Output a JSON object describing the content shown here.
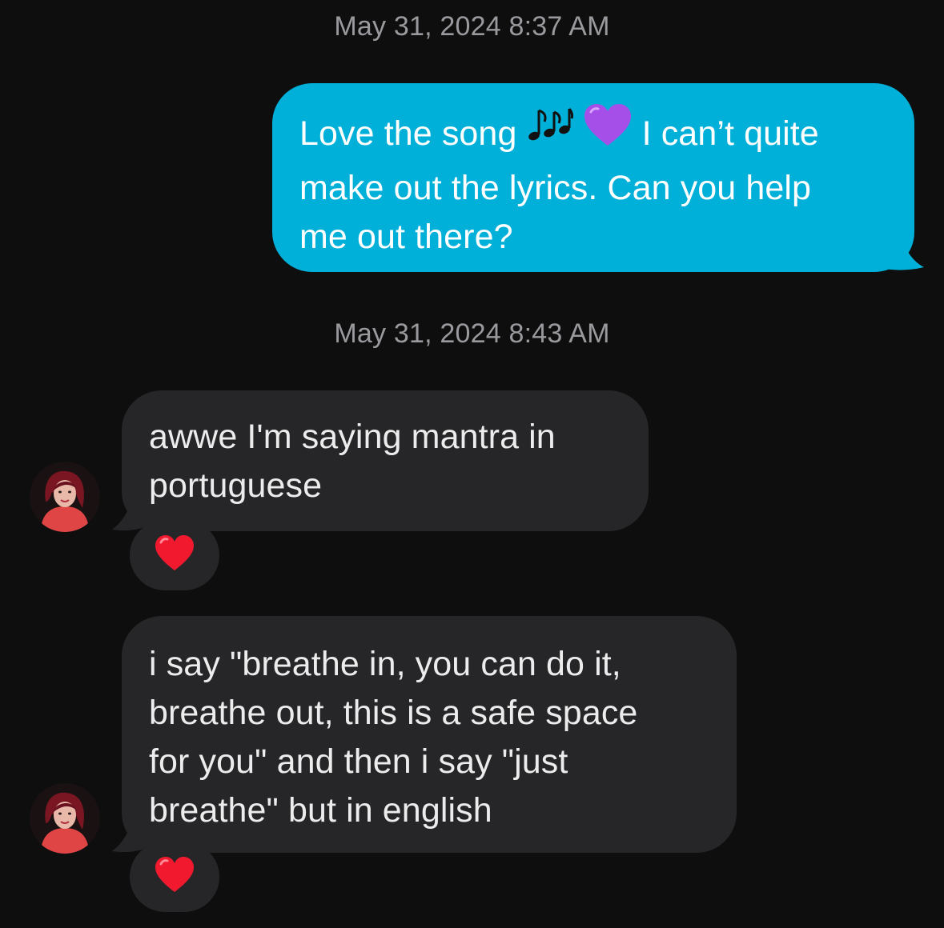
{
  "conversation": {
    "timestamps": [
      "May 31, 2024 8:37 AM",
      "May 31, 2024 8:43 AM"
    ],
    "outgoing": {
      "part1": "Love the song",
      "part2": "I can’t quite",
      "line2": "make out the lyrics. Can you help",
      "line3": "me out there?",
      "icons": [
        "music-notes-icon",
        "purple-heart-icon"
      ],
      "color": "#00b0d8"
    },
    "incoming": [
      {
        "lines": [
          "awwe I'm saying  mantra in",
          "portuguese"
        ],
        "reaction": "red-heart-icon"
      },
      {
        "lines": [
          "i say \"breathe in, you can do it,",
          "breathe out, this is a safe space",
          "for you\" and then i say \"just",
          "breathe\" but in english"
        ],
        "reaction": "red-heart-icon"
      }
    ],
    "incoming_color": "#262628",
    "background_color": "#0e0e0e"
  }
}
